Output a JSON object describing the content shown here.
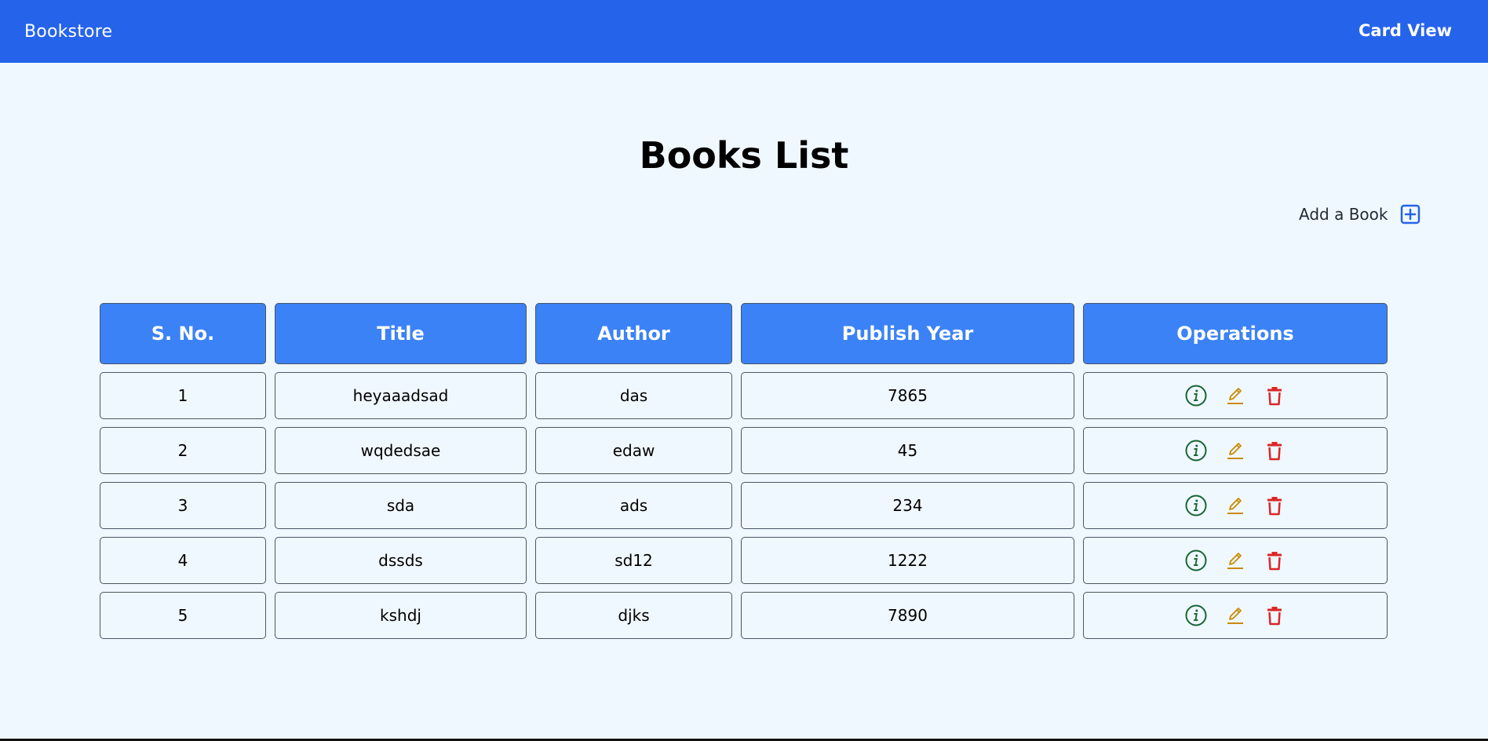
{
  "navbar": {
    "brand": "Bookstore",
    "card_view_label": "Card View",
    "background_color": "#2563eb"
  },
  "page": {
    "title": "Books List"
  },
  "add_book": {
    "label": "Add a Book",
    "icon": "plus-square-icon",
    "icon_color": "#2563eb"
  },
  "table": {
    "header_color": "#3b82f6",
    "headers": [
      "S. No.",
      "Title",
      "Author",
      "Publish Year",
      "Operations"
    ],
    "rows": [
      {
        "sno": "1",
        "title": "heyaaadsad",
        "author": "das",
        "year": "7865"
      },
      {
        "sno": "2",
        "title": "wqdedsae",
        "author": "edaw",
        "year": "45"
      },
      {
        "sno": "3",
        "title": "sda",
        "author": "ads",
        "year": "234"
      },
      {
        "sno": "4",
        "title": "dssds",
        "author": "sd12",
        "year": "1222"
      },
      {
        "sno": "5",
        "title": "kshdj",
        "author": "djks",
        "year": "7890"
      }
    ],
    "operations": [
      {
        "icon": "info-circle-icon",
        "color": "#166534"
      },
      {
        "icon": "pencil-edit-icon",
        "color": "#ca8a04"
      },
      {
        "icon": "trash-delete-icon",
        "color": "#dc2626"
      }
    ]
  }
}
